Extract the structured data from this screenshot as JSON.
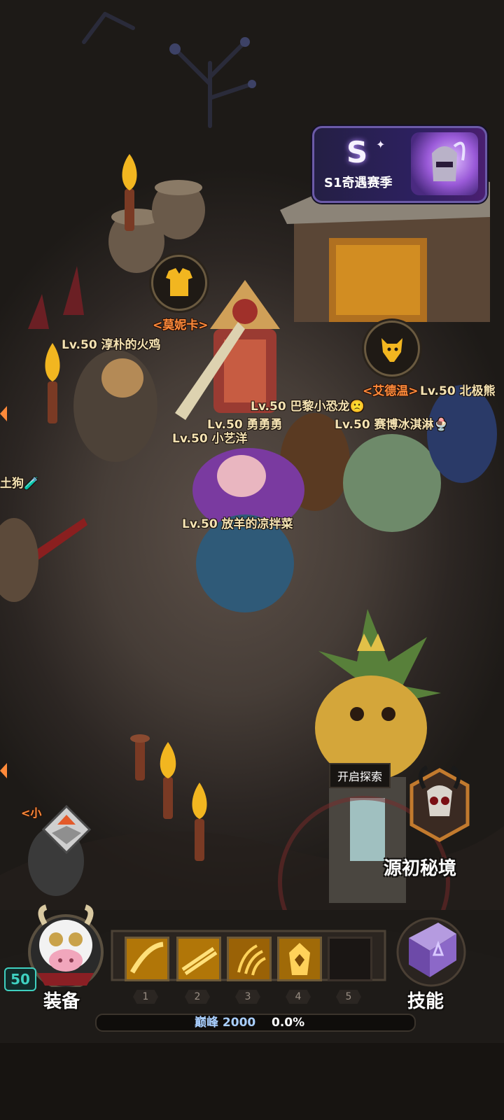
{
  "season_banner": {
    "label": "S1奇遇赛季",
    "badge": "S"
  },
  "npcs": [
    {
      "name": "<莫妮卡>"
    },
    {
      "name": "<艾德温>"
    },
    {
      "name": "<小"
    }
  ],
  "players": [
    {
      "name": "Lv.50 淳朴的火鸡"
    },
    {
      "name": "Lv.50 北极熊"
    },
    {
      "name": "Lv.50 巴黎小恐龙🙁"
    },
    {
      "name": "Lv.50 勇勇勇"
    },
    {
      "name": "Lv.50 赛博冰淇淋🍨"
    },
    {
      "name": "Lv.50 小艺洋"
    },
    {
      "name": "Lv.50 放羊的凉拌菜"
    },
    {
      "name": "土狗🧪"
    }
  ],
  "explore": {
    "prompt": "开启探索",
    "dungeon_label": "源初秘境"
  },
  "hud": {
    "level": "50",
    "equip_label": "装备",
    "skills_label": "技能",
    "skill_slots": [
      "1",
      "2",
      "3",
      "4",
      "5"
    ],
    "peak_label": "巅峰 2000",
    "peak_progress": "0.0%",
    "peak_fraction": 0.0
  },
  "colors": {
    "gold": "#f2b620",
    "name_cream": "#f4e2b2",
    "npc_orange": "#ff8a3a",
    "level_teal": "#3fd0c0"
  },
  "icons": {
    "npc_monica": "armor-icon",
    "npc_edwin": "fox-head-icon",
    "dungeon": "skull-helmet-icon",
    "skills": "spellbook-icon",
    "equip": "cow-avatar"
  }
}
